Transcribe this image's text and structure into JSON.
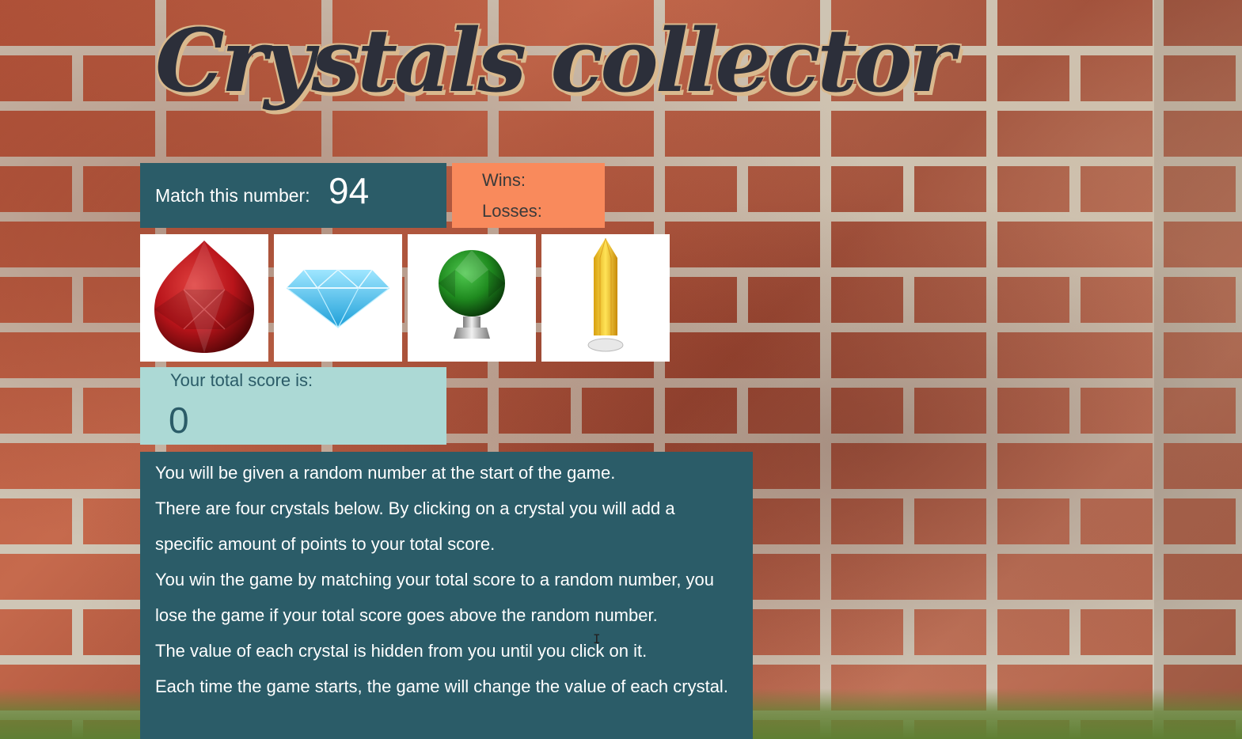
{
  "title": "Crystals collector",
  "match": {
    "label": "Match this number:",
    "value": "94"
  },
  "stats": {
    "wins_label": "Wins:",
    "losses_label": "Losses:"
  },
  "crystals": [
    {
      "name": "red crystal",
      "color": "#b8141a",
      "icon": "red-drop-crystal-icon"
    },
    {
      "name": "blue diamond",
      "color": "#3ec4f0",
      "icon": "blue-diamond-icon"
    },
    {
      "name": "green crystal knob",
      "color": "#1f8a1f",
      "icon": "green-crystal-knob-icon"
    },
    {
      "name": "yellow crystal",
      "color": "#f2c81a",
      "icon": "yellow-crystal-icon"
    }
  ],
  "score": {
    "label": "Your total score is:",
    "value": "0"
  },
  "instructions": [
    "You will be given a random number at the start of the game.",
    "There are four crystals below. By clicking on a crystal you will add a specific amount of points to your total score.",
    "You win the game by matching your total score to a random number, you lose the game if your total score goes above the random number.",
    "The value of each crystal is hidden from you until you click on it.",
    "Each time the game starts, the game will change the value of each crystal."
  ],
  "colors": {
    "panel_dark": "#2b5c68",
    "panel_orange": "#f98a5c",
    "panel_light": "#acd9d5",
    "title": "#2c2f3a"
  }
}
